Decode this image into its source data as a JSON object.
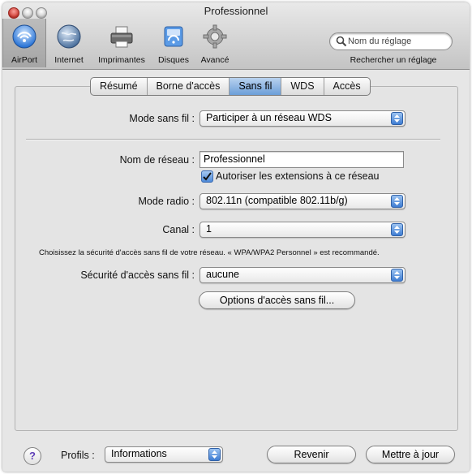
{
  "window": {
    "title": "Professionnel"
  },
  "toolbar": {
    "items": [
      {
        "label": "AirPort",
        "icon": "airport-icon"
      },
      {
        "label": "Internet",
        "icon": "globe-icon"
      },
      {
        "label": "Imprimantes",
        "icon": "printer-icon"
      },
      {
        "label": "Disques",
        "icon": "disk-icon"
      },
      {
        "label": "Avancé",
        "icon": "gear-icon"
      }
    ],
    "selected": "AirPort",
    "search_placeholder": "Nom du réglage",
    "search_caption": "Rechercher un réglage"
  },
  "tabs": [
    {
      "label": "Résumé"
    },
    {
      "label": "Borne d'accès"
    },
    {
      "label": "Sans fil"
    },
    {
      "label": "WDS"
    },
    {
      "label": "Accès"
    }
  ],
  "active_tab": "Sans fil",
  "form": {
    "wireless_mode_label": "Mode sans fil :",
    "wireless_mode_value": "Participer à un réseau WDS",
    "network_name_label": "Nom de réseau :",
    "network_name_value": "Professionnel",
    "allow_extensions_label": "Autoriser les extensions à ce réseau",
    "allow_extensions_checked": true,
    "radio_mode_label": "Mode radio :",
    "radio_mode_value": "802.11n (compatible 802.11b/g)",
    "channel_label": "Canal :",
    "channel_value": "1",
    "security_hint": "Choisissez la sécurité d'accès sans fil de votre réseau. « WPA/WPA2 Personnel » est recommandé.",
    "security_label": "Sécurité d'accès sans fil :",
    "security_value": "aucune",
    "options_button": "Options d'accès sans fil..."
  },
  "footer": {
    "help_label": "?",
    "profiles_label": "Profils :",
    "profiles_value": "Informations",
    "revert_button": "Revenir",
    "update_button": "Mettre à jour"
  },
  "colors": {
    "accent": "#4d8ad9",
    "help_glyph": "#5f3fb8"
  }
}
